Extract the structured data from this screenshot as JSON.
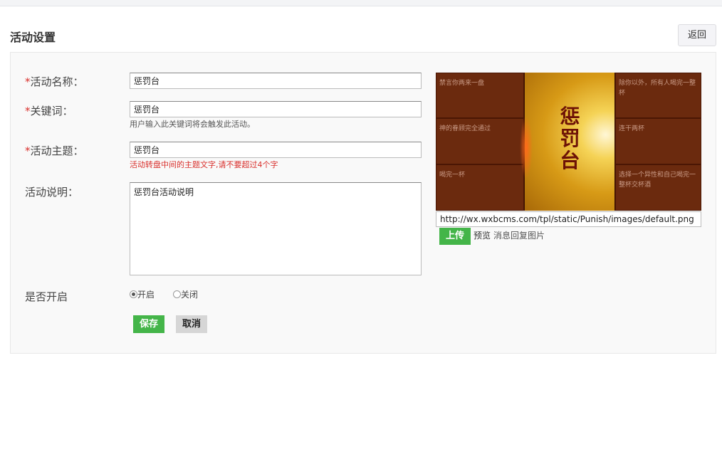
{
  "header": {
    "title": "活动设置",
    "back_label": "返回"
  },
  "form": {
    "required_mark": "*",
    "name": {
      "label": "活动名称：",
      "value": "惩罚台"
    },
    "keyword": {
      "label": "关键词：",
      "value": "惩罚台",
      "hint": "用户输入此关键词将会触发此活动。"
    },
    "theme": {
      "label": "活动主题：",
      "value": "惩罚台",
      "hint": "活动转盘中间的主题文字,请不要超过4个字"
    },
    "description": {
      "label": "活动说明：",
      "value": "惩罚台活动说明"
    },
    "enabled": {
      "label": "是否开启",
      "on_label": "开启",
      "off_label": "关闭",
      "selected": "开启"
    },
    "save_label": "保存",
    "cancel_label": "取消"
  },
  "image": {
    "center_title": "惩罚台",
    "cells": [
      "禁言你两来一盘",
      "神的眷顾完全通过",
      "喝完一杯",
      "除你以外，所有人喝完一整杯",
      "连干两杯",
      "选择一个异性和自己喝完一整杯交杯酒"
    ],
    "url": "http://wx.wxbcms.com/tpl/static/Punish/images/default.png",
    "upload_label": "上传",
    "preview_label": "预览",
    "note": "消息回复图片"
  },
  "colors": {
    "accent_green": "#44b549",
    "required_red": "#d9302c"
  }
}
